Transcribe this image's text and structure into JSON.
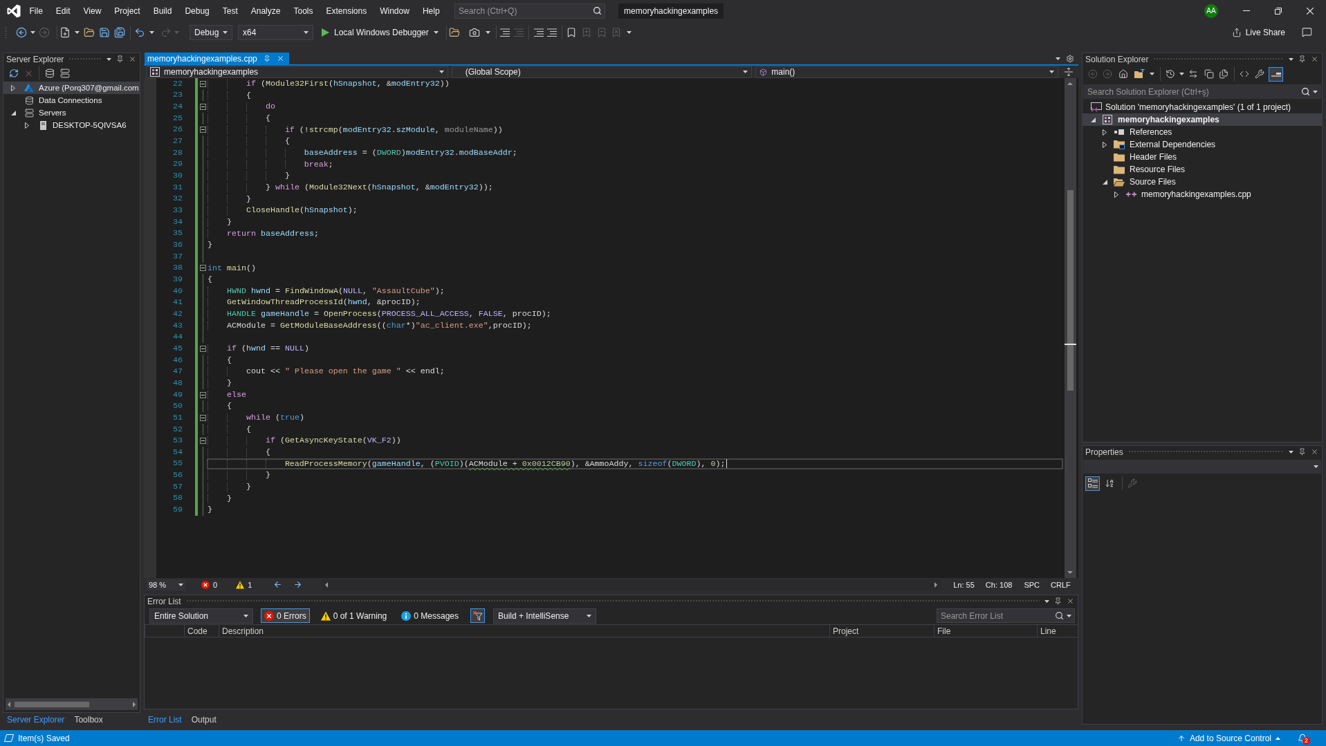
{
  "window": {
    "title": "memoryhackingexamples",
    "account": "AA"
  },
  "menu": [
    "File",
    "Edit",
    "View",
    "Project",
    "Build",
    "Debug",
    "Test",
    "Analyze",
    "Tools",
    "Extensions",
    "Window",
    "Help"
  ],
  "search": {
    "placeholder": "Search (Ctrl+Q)"
  },
  "toolbar": {
    "configuration": "Debug",
    "platform": "x64",
    "run": "Local Windows Debugger",
    "live_share": "Live Share"
  },
  "server_explorer": {
    "title": "Server Explorer",
    "items": [
      {
        "label": "Azure (Porq307@gmail.com",
        "kind": "azure",
        "expanded": false,
        "selected": true
      },
      {
        "label": "Data Connections",
        "kind": "data",
        "selected": false
      },
      {
        "label": "Servers",
        "kind": "servers",
        "expanded": true,
        "selected": false,
        "children": [
          {
            "label": "DESKTOP-5QIVSA6",
            "kind": "machine",
            "expanded": false,
            "selected": false
          }
        ]
      }
    ],
    "tabs": [
      {
        "label": "Server Explorer",
        "selected": true
      },
      {
        "label": "Toolbox",
        "selected": false
      }
    ]
  },
  "editor": {
    "tab": {
      "label": "memoryhackingexamples.cpp",
      "selected": true
    },
    "navigation": {
      "project": "memoryhackingexamples",
      "scope": "(Global Scope)",
      "member": "main()"
    },
    "lines": [
      {
        "number": "22",
        "fold": true,
        "changed": true,
        "current": false,
        "tokens": [
          {
            "kind": "control",
            "text": "        if"
          },
          {
            "kind": "plain",
            "text": " ("
          },
          {
            "kind": "function",
            "text": "Module32First"
          },
          {
            "kind": "plain",
            "text": "("
          },
          {
            "kind": "variable",
            "text": "hSnapshot"
          },
          {
            "kind": "plain",
            "text": ", &"
          },
          {
            "kind": "variable",
            "text": "modEntry32"
          },
          {
            "kind": "plain",
            "text": "))"
          }
        ]
      },
      {
        "number": "23",
        "fold": false,
        "changed": true,
        "current": false,
        "tokens": [
          {
            "kind": "plain",
            "text": "        {"
          }
        ]
      },
      {
        "number": "24",
        "fold": true,
        "changed": true,
        "current": false,
        "tokens": [
          {
            "kind": "control",
            "text": "            do"
          }
        ]
      },
      {
        "number": "25",
        "fold": false,
        "changed": true,
        "current": false,
        "tokens": [
          {
            "kind": "plain",
            "text": "            {"
          }
        ]
      },
      {
        "number": "26",
        "fold": true,
        "changed": true,
        "current": false,
        "tokens": [
          {
            "kind": "control",
            "text": "                if"
          },
          {
            "kind": "plain",
            "text": " (!"
          },
          {
            "kind": "function",
            "text": "strcmp"
          },
          {
            "kind": "plain",
            "text": "("
          },
          {
            "kind": "variable",
            "text": "modEntry32"
          },
          {
            "kind": "plain",
            "text": "."
          },
          {
            "kind": "variable",
            "text": "szModule"
          },
          {
            "kind": "plain",
            "text": ", "
          },
          {
            "kind": "parameter",
            "text": "moduleName"
          },
          {
            "kind": "plain",
            "text": "))"
          }
        ]
      },
      {
        "number": "27",
        "fold": false,
        "changed": true,
        "current": false,
        "tokens": [
          {
            "kind": "plain",
            "text": "                {"
          }
        ]
      },
      {
        "number": "28",
        "fold": false,
        "changed": true,
        "current": false,
        "tokens": [
          {
            "kind": "variable",
            "text": "                    baseAddress"
          },
          {
            "kind": "plain",
            "text": " = ("
          },
          {
            "kind": "type",
            "text": "DWORD"
          },
          {
            "kind": "plain",
            "text": ")"
          },
          {
            "kind": "variable",
            "text": "modEntry32"
          },
          {
            "kind": "plain",
            "text": "."
          },
          {
            "kind": "variable",
            "text": "modBaseAddr"
          },
          {
            "kind": "plain",
            "text": ";"
          }
        ]
      },
      {
        "number": "29",
        "fold": false,
        "changed": true,
        "current": false,
        "tokens": [
          {
            "kind": "control",
            "text": "                    break"
          },
          {
            "kind": "plain",
            "text": ";"
          }
        ]
      },
      {
        "number": "30",
        "fold": false,
        "changed": true,
        "current": false,
        "tokens": [
          {
            "kind": "plain",
            "text": "                }"
          }
        ]
      },
      {
        "number": "31",
        "fold": false,
        "changed": true,
        "current": false,
        "tokens": [
          {
            "kind": "plain",
            "text": "            } "
          },
          {
            "kind": "control",
            "text": "while"
          },
          {
            "kind": "plain",
            "text": " ("
          },
          {
            "kind": "function",
            "text": "Module32Next"
          },
          {
            "kind": "plain",
            "text": "("
          },
          {
            "kind": "variable",
            "text": "hSnapshot"
          },
          {
            "kind": "plain",
            "text": ", &"
          },
          {
            "kind": "variable",
            "text": "modEntry32"
          },
          {
            "kind": "plain",
            "text": "));"
          }
        ]
      },
      {
        "number": "32",
        "fold": false,
        "changed": true,
        "current": false,
        "tokens": [
          {
            "kind": "plain",
            "text": "        }"
          }
        ]
      },
      {
        "number": "33",
        "fold": false,
        "changed": true,
        "current": false,
        "tokens": [
          {
            "kind": "function",
            "text": "        CloseHandle"
          },
          {
            "kind": "plain",
            "text": "("
          },
          {
            "kind": "variable",
            "text": "hSnapshot"
          },
          {
            "kind": "plain",
            "text": ");"
          }
        ]
      },
      {
        "number": "34",
        "fold": false,
        "changed": true,
        "current": false,
        "tokens": [
          {
            "kind": "plain",
            "text": "    }"
          }
        ]
      },
      {
        "number": "35",
        "fold": false,
        "changed": true,
        "current": false,
        "tokens": [
          {
            "kind": "control",
            "text": "    return "
          },
          {
            "kind": "variable",
            "text": "baseAddress"
          },
          {
            "kind": "plain",
            "text": ";"
          }
        ]
      },
      {
        "number": "36",
        "fold": false,
        "changed": true,
        "current": false,
        "tokens": [
          {
            "kind": "plain",
            "text": "}"
          }
        ]
      },
      {
        "number": "37",
        "fold": false,
        "changed": true,
        "current": false
      },
      {
        "number": "38",
        "fold": true,
        "changed": true,
        "current": false,
        "tokens": [
          {
            "kind": "keyword",
            "text": "int "
          },
          {
            "kind": "function",
            "text": "main"
          },
          {
            "kind": "plain",
            "text": "()"
          }
        ]
      },
      {
        "number": "39",
        "fold": false,
        "changed": true,
        "current": false,
        "tokens": [
          {
            "kind": "plain",
            "text": "{"
          }
        ]
      },
      {
        "number": "40",
        "fold": false,
        "changed": true,
        "current": false,
        "tokens": [
          {
            "kind": "type",
            "text": "    HWND "
          },
          {
            "kind": "variable",
            "text": "hwnd"
          },
          {
            "kind": "plain",
            "text": " = "
          },
          {
            "kind": "function",
            "text": "FindWindowA"
          },
          {
            "kind": "plain",
            "text": "("
          },
          {
            "kind": "macro",
            "text": "NULL"
          },
          {
            "kind": "plain",
            "text": ", "
          },
          {
            "kind": "string",
            "text": "\"AssaultCube\""
          },
          {
            "kind": "plain",
            "text": ");"
          }
        ]
      },
      {
        "number": "41",
        "fold": false,
        "changed": true,
        "current": false,
        "tokens": [
          {
            "kind": "function",
            "text": "    GetWindowThreadProcessId"
          },
          {
            "kind": "plain",
            "text": "("
          },
          {
            "kind": "variable",
            "text": "hwnd"
          },
          {
            "kind": "plain",
            "text": ", &procID);"
          }
        ]
      },
      {
        "number": "42",
        "fold": false,
        "changed": true,
        "current": false,
        "tokens": [
          {
            "kind": "type",
            "text": "    HANDLE "
          },
          {
            "kind": "variable",
            "text": "gameHandle"
          },
          {
            "kind": "plain",
            "text": " = "
          },
          {
            "kind": "function",
            "text": "OpenProcess"
          },
          {
            "kind": "plain",
            "text": "("
          },
          {
            "kind": "macro",
            "text": "PROCESS_ALL_ACCESS"
          },
          {
            "kind": "plain",
            "text": ", "
          },
          {
            "kind": "macro",
            "text": "FALSE"
          },
          {
            "kind": "plain",
            "text": ", procID);"
          }
        ]
      },
      {
        "number": "43",
        "fold": false,
        "changed": true,
        "current": false,
        "tokens": [
          {
            "kind": "plain",
            "text": "    ACModule = "
          },
          {
            "kind": "function",
            "text": "GetModuleBaseAddress"
          },
          {
            "kind": "plain",
            "text": "(("
          },
          {
            "kind": "keyword",
            "text": "char"
          },
          {
            "kind": "plain",
            "text": "*)"
          },
          {
            "kind": "string",
            "text": "\"ac_client.exe\""
          },
          {
            "kind": "plain",
            "text": ",procID);"
          }
        ]
      },
      {
        "number": "44",
        "fold": false,
        "changed": true,
        "current": false
      },
      {
        "number": "45",
        "fold": true,
        "changed": true,
        "current": false,
        "tokens": [
          {
            "kind": "control",
            "text": "    if"
          },
          {
            "kind": "plain",
            "text": " ("
          },
          {
            "kind": "variable",
            "text": "hwnd"
          },
          {
            "kind": "plain",
            "text": " == "
          },
          {
            "kind": "macro",
            "text": "NULL"
          },
          {
            "kind": "plain",
            "text": ")"
          }
        ]
      },
      {
        "number": "46",
        "fold": false,
        "changed": true,
        "current": false,
        "tokens": [
          {
            "kind": "plain",
            "text": "    {"
          }
        ]
      },
      {
        "number": "47",
        "fold": false,
        "changed": true,
        "current": false,
        "tokens": [
          {
            "kind": "plain",
            "text": "        cout << "
          },
          {
            "kind": "string",
            "text": "\" Please open the game \""
          },
          {
            "kind": "plain",
            "text": " << endl;"
          }
        ]
      },
      {
        "number": "48",
        "fold": false,
        "changed": true,
        "current": false,
        "tokens": [
          {
            "kind": "plain",
            "text": "    }"
          }
        ]
      },
      {
        "number": "49",
        "fold": true,
        "changed": true,
        "current": false,
        "tokens": [
          {
            "kind": "control",
            "text": "    else"
          }
        ]
      },
      {
        "number": "50",
        "fold": false,
        "changed": true,
        "current": false,
        "tokens": [
          {
            "kind": "plain",
            "text": "    {"
          }
        ]
      },
      {
        "number": "51",
        "fold": true,
        "changed": true,
        "current": false,
        "tokens": [
          {
            "kind": "control",
            "text": "        while"
          },
          {
            "kind": "plain",
            "text": " ("
          },
          {
            "kind": "keyword",
            "text": "true"
          },
          {
            "kind": "plain",
            "text": ")"
          }
        ]
      },
      {
        "number": "52",
        "fold": false,
        "changed": true,
        "current": false,
        "tokens": [
          {
            "kind": "plain",
            "text": "        {"
          }
        ]
      },
      {
        "number": "53",
        "fold": true,
        "changed": true,
        "current": false,
        "tokens": [
          {
            "kind": "control",
            "text": "            if"
          },
          {
            "kind": "plain",
            "text": " ("
          },
          {
            "kind": "function",
            "text": "GetAsyncKeyState"
          },
          {
            "kind": "plain",
            "text": "("
          },
          {
            "kind": "macro",
            "text": "VK_F2"
          },
          {
            "kind": "plain",
            "text": "))"
          }
        ]
      },
      {
        "number": "54",
        "fold": false,
        "changed": true,
        "current": false,
        "tokens": [
          {
            "kind": "plain",
            "text": "            {"
          }
        ]
      },
      {
        "number": "55",
        "fold": false,
        "changed": true,
        "current": true,
        "tokens": [
          {
            "kind": "function",
            "text": "                ReadProcessMemory"
          },
          {
            "kind": "plain",
            "text": "("
          },
          {
            "kind": "variable",
            "text": "gameHandle"
          },
          {
            "kind": "plain",
            "text": ", ("
          },
          {
            "kind": "type",
            "text": "PVOID"
          },
          {
            "kind": "plain",
            "text": ")("
          },
          {
            "kind": "plain",
            "text": "ACModule + ",
            "squiggle": true
          },
          {
            "kind": "number",
            "text": "0x0012CB90",
            "squiggle": true
          },
          {
            "kind": "plain",
            "text": "), &AmmoAddy, "
          },
          {
            "kind": "keyword",
            "text": "sizeof"
          },
          {
            "kind": "plain",
            "text": "("
          },
          {
            "kind": "type",
            "text": "DWORD"
          },
          {
            "kind": "plain",
            "text": "), "
          },
          {
            "kind": "number",
            "text": "0"
          },
          {
            "kind": "plain",
            "text": ");"
          }
        ]
      },
      {
        "number": "56",
        "fold": false,
        "changed": true,
        "current": false,
        "tokens": [
          {
            "kind": "plain",
            "text": "            }"
          }
        ]
      },
      {
        "number": "57",
        "fold": false,
        "changed": true,
        "current": false,
        "tokens": [
          {
            "kind": "plain",
            "text": "        }"
          }
        ]
      },
      {
        "number": "58",
        "fold": false,
        "changed": true,
        "current": false,
        "tokens": [
          {
            "kind": "plain",
            "text": "    }"
          }
        ]
      },
      {
        "number": "59",
        "fold": false,
        "changed": true,
        "current": false,
        "tokens": [
          {
            "kind": "plain",
            "text": "}"
          }
        ]
      }
    ],
    "status": {
      "zoom": "98 %",
      "errors": "0",
      "warnings": "1",
      "line": "Ln: 55",
      "column": "Ch: 108",
      "indent": "SPC",
      "line_endings": "CRLF"
    }
  },
  "error_list": {
    "title": "Error List",
    "scope": "Entire Solution",
    "filters": [
      {
        "kind": "error",
        "label": "0 Errors",
        "on": true
      },
      {
        "kind": "warning",
        "label": "0 of 1 Warning",
        "on": false
      },
      {
        "kind": "message",
        "label": "0 Messages",
        "on": false
      }
    ],
    "build_filter_on": true,
    "source": "Build + IntelliSense",
    "search": {
      "placeholder": "Search Error List"
    },
    "columns": [
      "Code",
      "Description",
      "Project",
      "File",
      "Line"
    ],
    "tabs": [
      {
        "label": "Error List",
        "selected": true
      },
      {
        "label": "Output",
        "selected": false
      }
    ]
  },
  "solution_explorer": {
    "title": "Solution Explorer",
    "preview_on": true,
    "search": {
      "placeholder": "Search Solution Explorer (Ctrl+ş)"
    },
    "tree": [
      {
        "label": "Solution 'memoryhackingexamples' (1 of 1 project)",
        "kind": "solution",
        "selected": false,
        "children": [
          {
            "label": "memoryhackingexamples",
            "kind": "project",
            "expanded": true,
            "selected": true,
            "children": [
              {
                "label": "References",
                "kind": "references",
                "expanded": false,
                "selected": false
              },
              {
                "label": "External Dependencies",
                "kind": "dependencies",
                "expanded": false,
                "selected": false
              },
              {
                "label": "Header Files",
                "kind": "folder",
                "selected": false
              },
              {
                "label": "Resource Files",
                "kind": "folder",
                "selected": false
              },
              {
                "label": "Source Files",
                "kind": "folder",
                "expanded": true,
                "selected": false,
                "children": [
                  {
                    "label": "memoryhackingexamples.cpp",
                    "kind": "cpp",
                    "expanded": false,
                    "selected": false
                  }
                ]
              }
            ]
          }
        ]
      }
    ]
  },
  "properties": {
    "title": "Properties",
    "views": [
      {
        "kind": "categorized",
        "selected": true
      },
      {
        "kind": "alphabetical",
        "selected": false
      }
    ]
  },
  "status_bar": {
    "message": "Item(s) Saved",
    "source_control": "Add to Source Control",
    "notifications": "2"
  }
}
